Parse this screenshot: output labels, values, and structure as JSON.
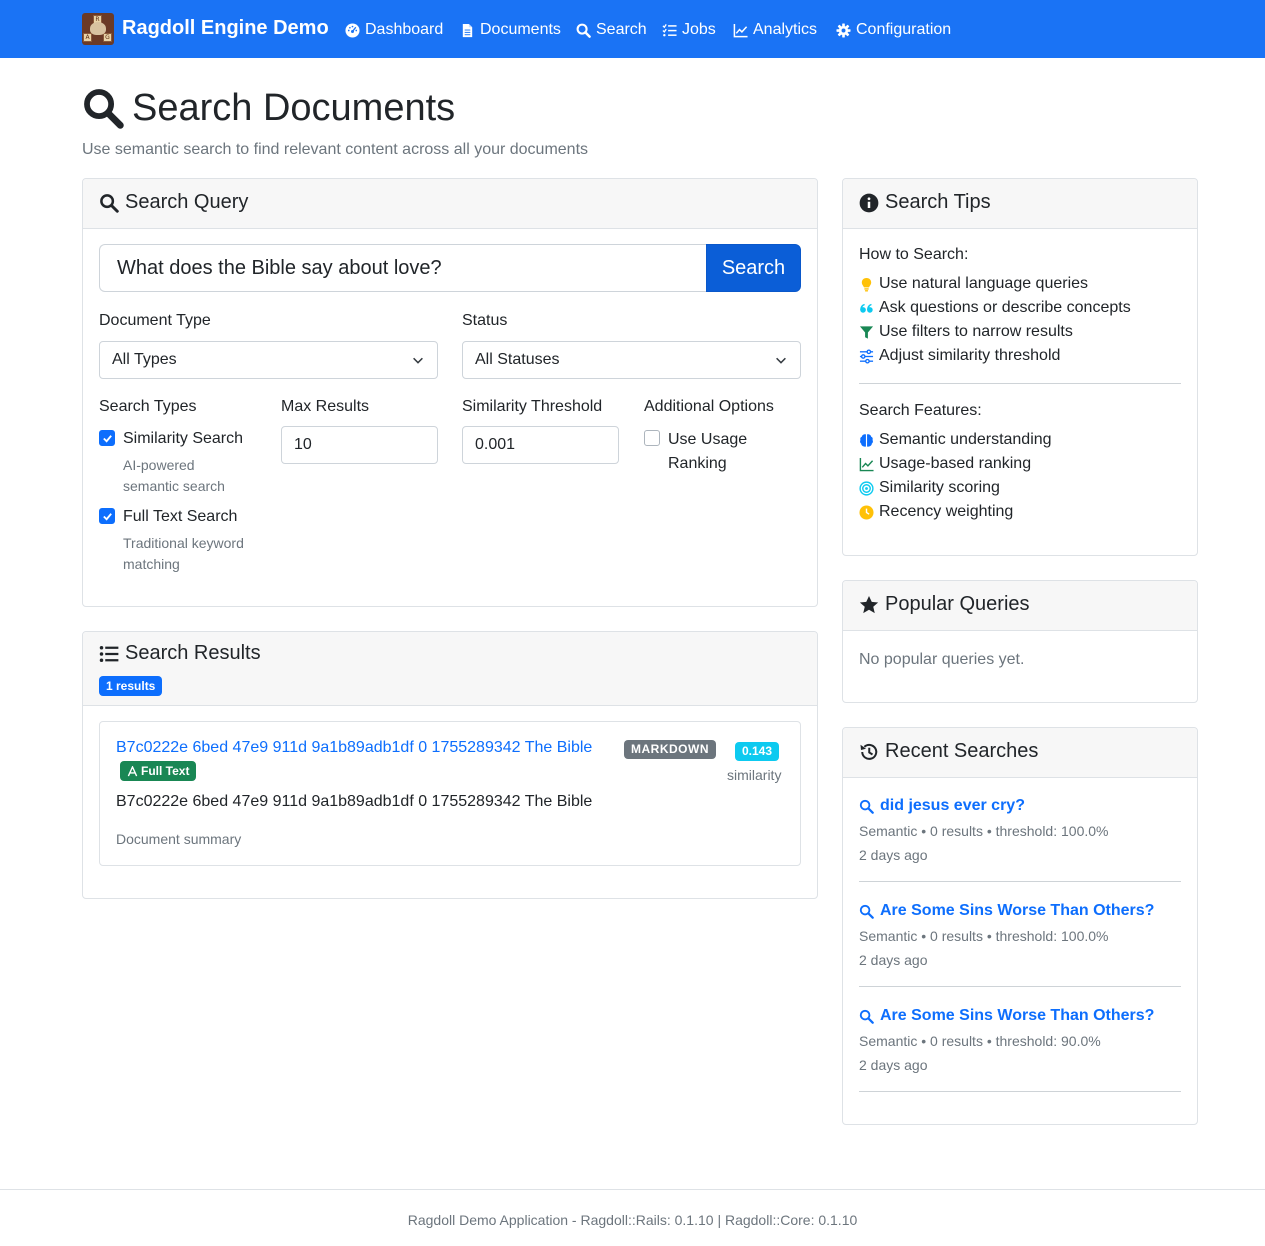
{
  "navbar": {
    "brand": "Ragdoll Engine Demo",
    "logo_letters": [
      "R",
      "A",
      "G"
    ],
    "items": [
      {
        "label": "Dashboard",
        "icon": "dashboard-icon"
      },
      {
        "label": "Documents",
        "icon": "document-icon"
      },
      {
        "label": "Search",
        "icon": "search-icon"
      },
      {
        "label": "Jobs",
        "icon": "list-check-icon"
      },
      {
        "label": "Analytics",
        "icon": "chart-line-icon"
      },
      {
        "label": "Configuration",
        "icon": "gear-icon"
      }
    ]
  },
  "page": {
    "title": "Search Documents",
    "subtitle": "Use semantic search to find relevant content across all your documents"
  },
  "search_query": {
    "header": "Search Query",
    "query_value": "What does the Bible say about love?",
    "search_button": "Search",
    "document_type_label": "Document Type",
    "document_type_value": "All Types",
    "status_label": "Status",
    "status_value": "All Statuses",
    "search_types_label": "Search Types",
    "similarity_search": {
      "label": "Similarity Search",
      "help_line1": "AI-powered",
      "help_line2": "semantic search",
      "checked": true
    },
    "full_text_search": {
      "label": "Full Text Search",
      "help_line1": "Traditional keyword",
      "help_line2": "matching",
      "checked": true
    },
    "max_results_label": "Max Results",
    "max_results_value": "10",
    "similarity_threshold_label": "Similarity Threshold",
    "similarity_threshold_value": "0.001",
    "additional_options_label": "Additional Options",
    "usage_ranking": {
      "label_line1": "Use Usage",
      "label_line2": "Ranking",
      "checked": false
    }
  },
  "search_results": {
    "header": "Search Results",
    "count_badge": "1 results",
    "results": [
      {
        "title": "B7c0222e 6bed 47e9 911d 9a1b89adb1df 0 1755289342 The Bible",
        "type_badge": "MARKDOWN",
        "match_badge": "Full Text",
        "similarity_value": "0.143",
        "similarity_label": "similarity",
        "content": "B7c0222e 6bed 47e9 911d 9a1b89adb1df 0 1755289342 The Bible",
        "summary": "Document summary"
      }
    ]
  },
  "search_tips": {
    "header": "Search Tips",
    "how_to_title": "How to Search:",
    "how_to_items": [
      {
        "text": "Use natural language queries",
        "icon": "lightbulb-icon"
      },
      {
        "text": "Ask questions or describe concepts",
        "icon": "quote-icon"
      },
      {
        "text": "Use filters to narrow results",
        "icon": "funnel-icon"
      },
      {
        "text": "Adjust similarity threshold",
        "icon": "sliders-icon"
      }
    ],
    "features_title": "Search Features:",
    "features_items": [
      {
        "text": "Semantic understanding",
        "icon": "brain-icon"
      },
      {
        "text": "Usage-based ranking",
        "icon": "chart-line-icon"
      },
      {
        "text": "Similarity scoring",
        "icon": "target-icon"
      },
      {
        "text": "Recency weighting",
        "icon": "clock-icon"
      }
    ]
  },
  "popular_queries": {
    "header": "Popular Queries",
    "empty_text": "No popular queries yet."
  },
  "recent_searches": {
    "header": "Recent Searches",
    "items": [
      {
        "query": "did jesus ever cry?",
        "meta": "Semantic • 0 results • threshold: 100.0%",
        "time": "2 days ago"
      },
      {
        "query": "Are Some Sins Worse Than Others?",
        "meta": "Semantic • 0 results • threshold: 100.0%",
        "time": "2 days ago"
      },
      {
        "query": "Are Some Sins Worse Than Others?",
        "meta": "Semantic • 0 results • threshold: 90.0%",
        "time": "2 days ago"
      }
    ]
  },
  "footer": {
    "text": "Ragdoll Demo Application - Ragdoll::Rails: 0.1.10 | Ragdoll::Core: 0.1.10"
  },
  "colors": {
    "navbar": "#1a73f5",
    "primary": "#0d6efd",
    "success": "#198754",
    "info": "#0dcaf0",
    "secondary": "#6c757d",
    "warning": "#ffc107"
  }
}
